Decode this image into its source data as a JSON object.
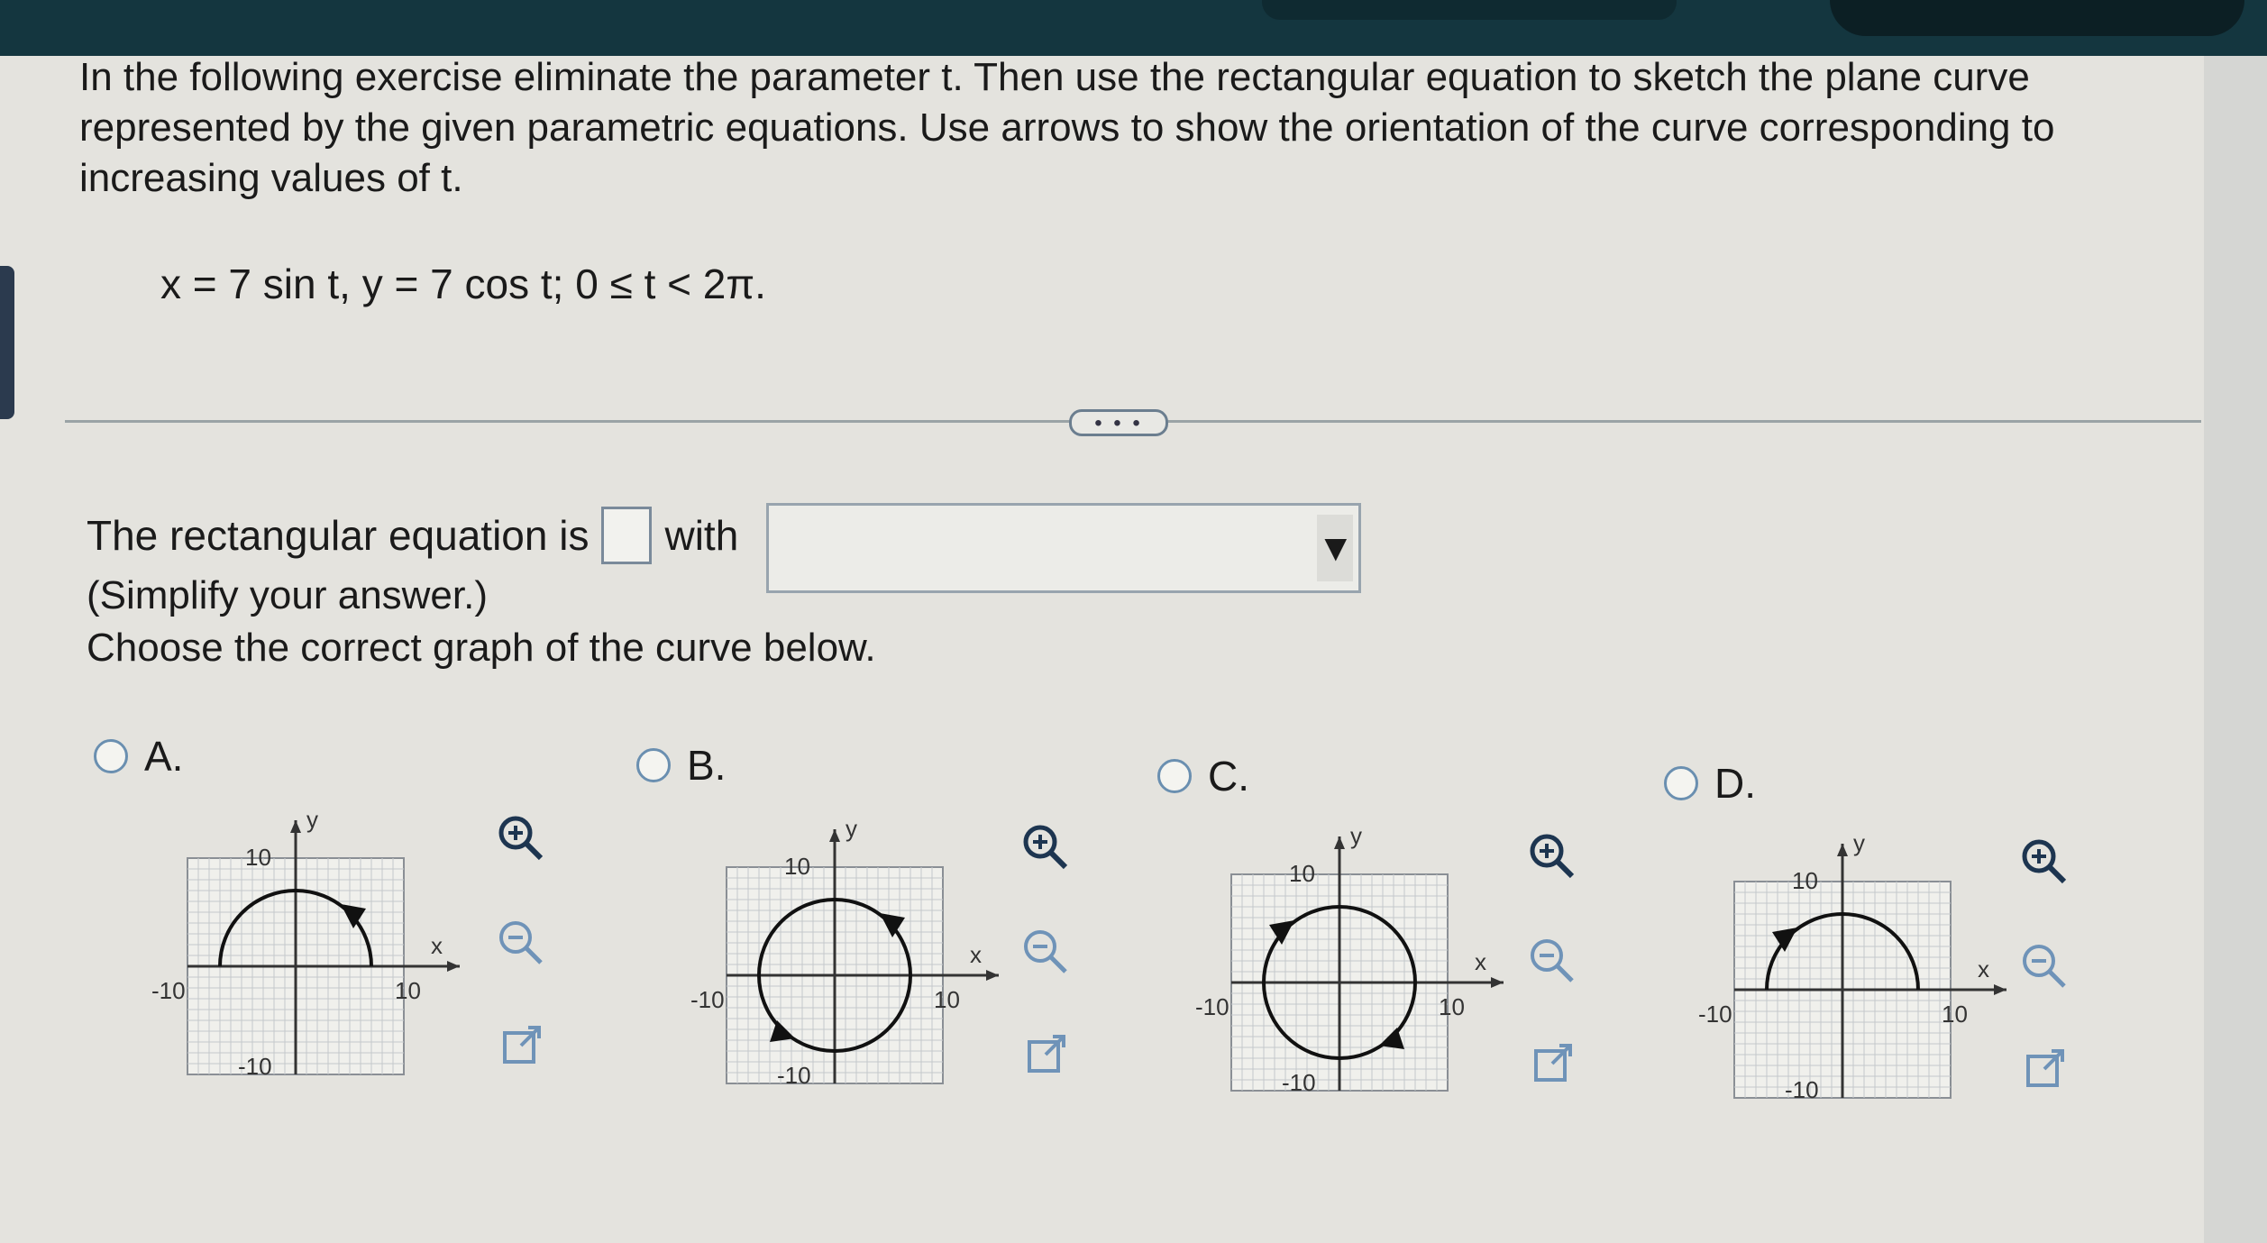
{
  "problem": {
    "line1": "In the following exercise eliminate the parameter t. Then use the rectangular equation to sketch the plane curve",
    "line2": "represented by the given parametric equations. Use arrows to show the orientation of the curve corresponding to",
    "line3": "increasing values of t.",
    "equation": "x = 7 sin t, y = 7 cos t; 0 ≤ t < 2π."
  },
  "expand_label": "• • •",
  "answer": {
    "prefix": "The rectangular equation is",
    "middle": "with",
    "simplify": "(Simplify your answer.)",
    "choose": "Choose the correct graph of the curve below.",
    "select_arrow": "▼"
  },
  "options": [
    {
      "letter": "A.",
      "curve": "upper-semicircle"
    },
    {
      "letter": "B.",
      "curve": "full-circle"
    },
    {
      "letter": "C.",
      "curve": "full-circle"
    },
    {
      "letter": "D.",
      "curve": "upper-semicircle"
    }
  ],
  "axis": {
    "x_label": "x",
    "y_label": "y",
    "pos_tick": "10",
    "neg_tick": "-10"
  },
  "icons": [
    "zoom-in-icon",
    "zoom-out-icon",
    "external-link-icon"
  ]
}
